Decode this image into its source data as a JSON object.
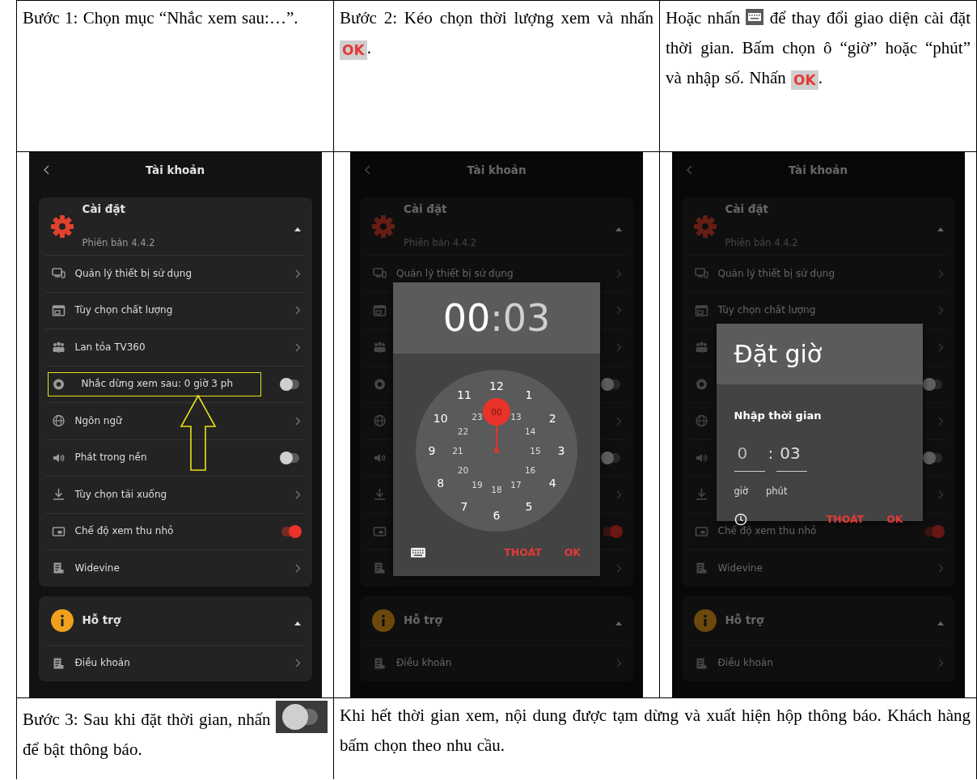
{
  "table": {
    "rows": [
      {
        "cells": [
          {
            "parts": [
              {
                "kind": "text",
                "text": "Bước 1: Chọn mục “Nhắc xem sau:…”."
              }
            ]
          },
          {
            "parts": [
              {
                "kind": "text",
                "text": "Bước 2: Kéo chọn thời lượng xem và nhấn "
              },
              {
                "kind": "ok_badge",
                "text": "OK"
              },
              {
                "kind": "text",
                "text": "."
              }
            ]
          },
          {
            "parts": [
              {
                "kind": "text",
                "text": "Hoặc nhấn "
              },
              {
                "kind": "keyboard_icon"
              },
              {
                "kind": "text",
                "text": " để thay đổi giao diện cài đặt thời gian. Bấm chọn ô “giờ” hoặc “phút” và nhập số. Nhấn "
              },
              {
                "kind": "ok_badge",
                "text": "OK"
              },
              {
                "kind": "text",
                "text": "."
              }
            ]
          }
        ]
      },
      {
        "cells": [
          {
            "screen": {
              "title": "Tài khoản",
              "sections": [
                {
                  "title": "Cài đặt",
                  "subtitle": "Phiên bản 4.4.2",
                  "expanded": true,
                  "items": [
                    {
                      "label": "Quản lý thiết bị sử dụng",
                      "kind": "link",
                      "highlighted": false
                    },
                    {
                      "label": "Tùy chọn chất lượng",
                      "kind": "link",
                      "highlighted": false
                    },
                    {
                      "label": "Lan tỏa TV360",
                      "kind": "link",
                      "highlighted": false
                    },
                    {
                      "label": "Nhắc dừng xem sau: 0 giờ 3 ph",
                      "kind": "switch",
                      "on": false,
                      "highlighted": true
                    },
                    {
                      "label": "Ngôn ngữ",
                      "kind": "link",
                      "highlighted": false
                    },
                    {
                      "label": "Phát trong nền",
                      "kind": "switch",
                      "on": false,
                      "highlighted": false
                    },
                    {
                      "label": "Tùy chọn tải xuống",
                      "kind": "link",
                      "highlighted": false
                    },
                    {
                      "label": "Chế độ xem thu nhỏ",
                      "kind": "switch",
                      "on": true,
                      "highlighted": false
                    },
                    {
                      "label": "Widevine",
                      "kind": "link",
                      "highlighted": false
                    }
                  ]
                },
                {
                  "title": "Hỗ trợ",
                  "expanded": true,
                  "items": [
                    {
                      "label": "Điều khoản",
                      "kind": "link",
                      "highlighted": false
                    }
                  ]
                }
              ]
            }
          },
          {
            "screen": {
              "title": "Tài khoản",
              "sections": [
                {
                  "title": "Cài đặt",
                  "subtitle": "Phiên bản 4.4.2",
                  "expanded": true,
                  "items": [
                    {
                      "label": "Quản lý thiết bị sử dụng",
                      "kind": "link"
                    },
                    {
                      "kind": "link"
                    },
                    {
                      "kind": "link"
                    },
                    {
                      "kind": "switch",
                      "on": false
                    },
                    {
                      "kind": "link"
                    },
                    {
                      "kind": "switch",
                      "on": false
                    },
                    {
                      "kind": "link"
                    },
                    {
                      "kind": "switch",
                      "on": true
                    },
                    {
                      "kind": "link"
                    }
                  ]
                },
                {
                  "title": "Hỗ trợ",
                  "expanded": true,
                  "items": [
                    {
                      "label": "Điều khoản",
                      "kind": "link"
                    }
                  ]
                }
              ],
              "dialog": {
                "kind": "clock",
                "hours": {
                  "text": "00",
                  "selected": true
                },
                "separator": ":",
                "minutes": {
                  "text": "03",
                  "selected": false
                },
                "outer": [
                  {
                    "label": "12",
                    "selected": false
                  },
                  {
                    "label": "1",
                    "selected": false
                  },
                  {
                    "label": "2",
                    "selected": false
                  },
                  {
                    "label": "3",
                    "selected": false
                  },
                  {
                    "label": "4",
                    "selected": false
                  },
                  {
                    "label": "5",
                    "selected": false
                  },
                  {
                    "label": "6",
                    "selected": false
                  },
                  {
                    "label": "7",
                    "selected": false
                  },
                  {
                    "label": "8",
                    "selected": false
                  },
                  {
                    "label": "9",
                    "selected": false
                  },
                  {
                    "label": "10",
                    "selected": false
                  },
                  {
                    "label": "11",
                    "selected": false
                  }
                ],
                "inner": [
                  {
                    "label": "00",
                    "selected": true
                  },
                  {
                    "label": "13",
                    "selected": false
                  },
                  {
                    "label": "14",
                    "selected": false
                  },
                  {
                    "label": "15",
                    "selected": false
                  },
                  {
                    "label": "16",
                    "selected": false
                  },
                  {
                    "label": "17",
                    "selected": false
                  },
                  {
                    "label": "18",
                    "selected": false
                  },
                  {
                    "label": "19",
                    "selected": false
                  },
                  {
                    "label": "20",
                    "selected": false
                  },
                  {
                    "label": "21",
                    "selected": false
                  },
                  {
                    "label": "22",
                    "selected": false
                  },
                  {
                    "label": "23",
                    "selected": false
                  }
                ],
                "buttons": [
                  "THOÁT",
                  "OK"
                ]
              }
            }
          },
          {
            "screen": {
              "title": "Tài khoản",
              "sections": [
                {
                  "title": "Cài đặt",
                  "subtitle": "Phiên bản 4.4.2",
                  "expanded": true,
                  "items": [
                    {
                      "label": "Quản lý thiết bị sử dụng",
                      "kind": "link"
                    },
                    {
                      "label": "Tùy chọn chất lượng",
                      "kind": "link"
                    },
                    {
                      "kind": "link"
                    },
                    {
                      "kind": "switch",
                      "on": false
                    },
                    {
                      "kind": "link"
                    },
                    {
                      "kind": "switch",
                      "on": false
                    },
                    {
                      "kind": "link"
                    },
                    {
                      "label": "Chế độ xem thu nhỏ",
                      "kind": "switch",
                      "on": true
                    },
                    {
                      "label": "Widevine",
                      "kind": "link"
                    }
                  ]
                },
                {
                  "title": "Hỗ trợ",
                  "expanded": true,
                  "items": [
                    {
                      "label": "Điều khoản",
                      "kind": "link"
                    }
                  ]
                }
              ],
              "dialog": {
                "kind": "input",
                "title": "Đặt giờ",
                "prompt": "Nhập thời gian",
                "hour": {
                  "value": "0",
                  "caption": "giờ"
                },
                "separator": ":",
                "minute": {
                  "value": "03",
                  "caption": "phút"
                },
                "buttons": [
                  "THOÁT",
                  "OK"
                ]
              }
            }
          }
        ]
      },
      {
        "cells": [
          {
            "parts": [
              {
                "kind": "text",
                "text": "Bước 3: Sau khi đặt thời gian, nhấn "
              },
              {
                "kind": "toggle_icon"
              },
              {
                "kind": "text",
                "text": " để bật thông báo."
              }
            ]
          },
          {
            "parts": [
              {
                "kind": "text",
                "text": "Khi hết thời gian xem, nội dung được tạm dừng và xuất hiện hộp thông báo. Khách hàng bấm chọn theo nhu cầu."
              }
            ]
          }
        ]
      }
    ]
  }
}
